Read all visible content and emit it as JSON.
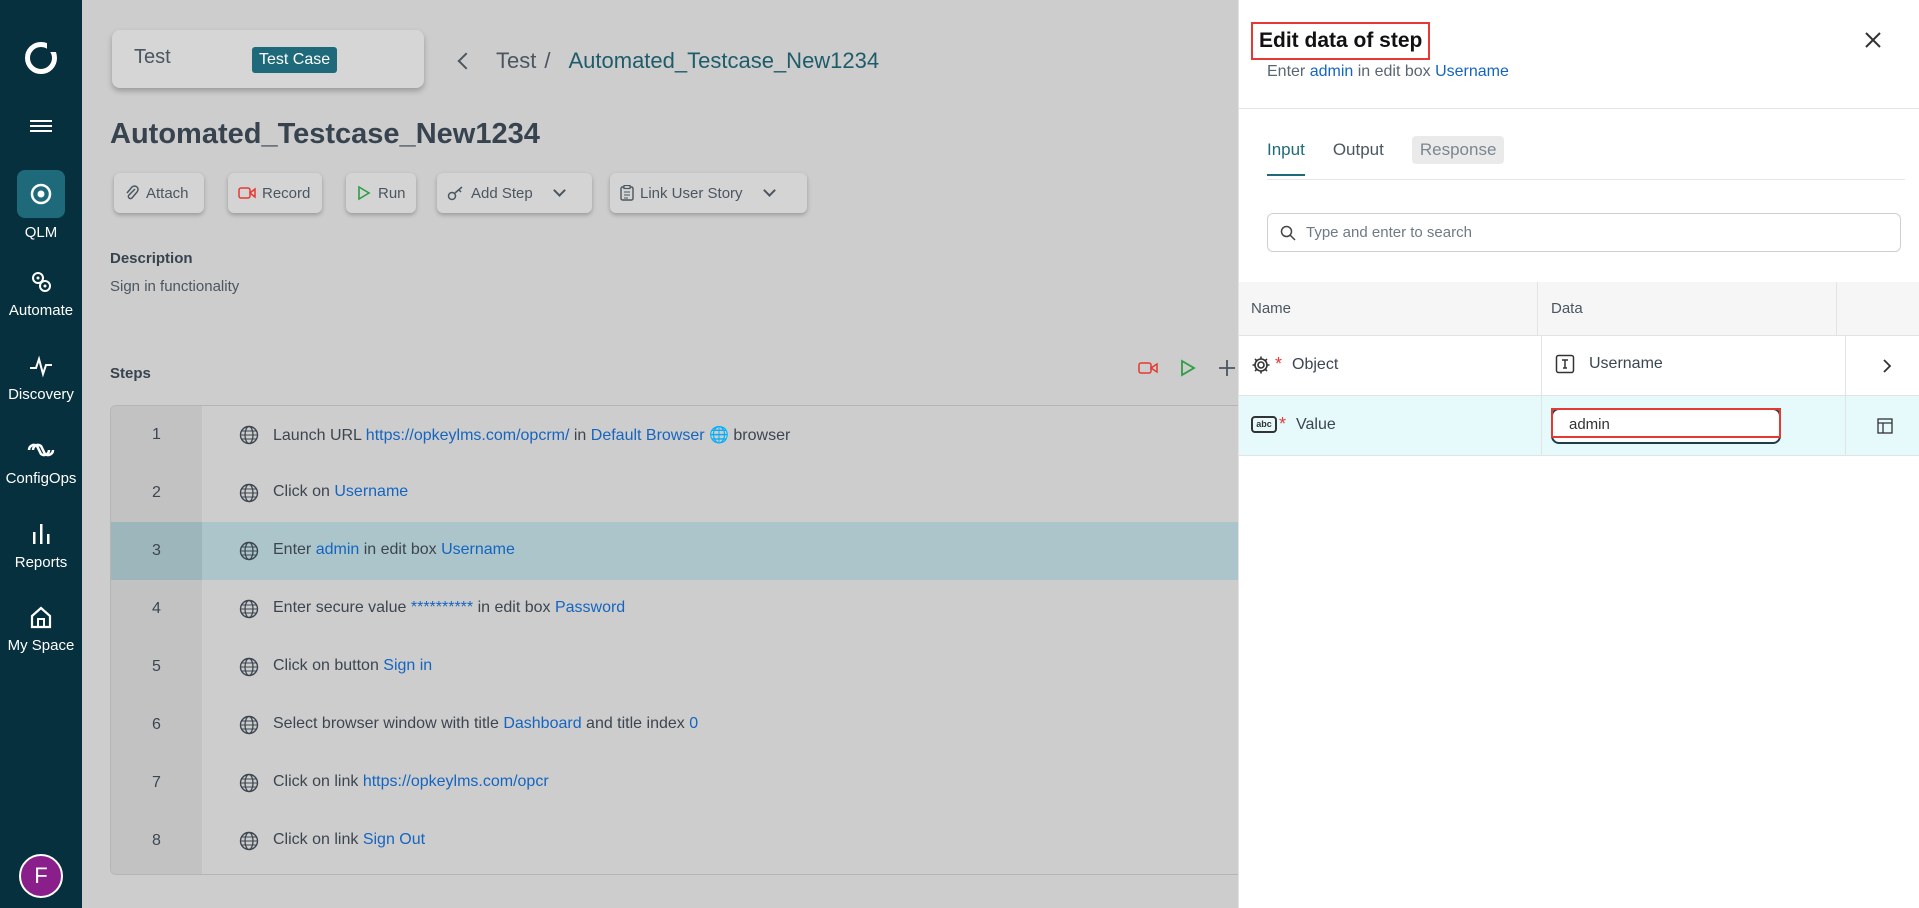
{
  "nav": {
    "items": [
      {
        "label": "QLM",
        "icon": "qlm-icon"
      },
      {
        "label": "Automate",
        "icon": "automate-icon"
      },
      {
        "label": "Discovery",
        "icon": "discovery-icon"
      },
      {
        "label": "ConfigOps",
        "icon": "configops-icon"
      },
      {
        "label": "Reports",
        "icon": "reports-icon"
      },
      {
        "label": "My Space",
        "icon": "home-icon"
      }
    ],
    "avatar_initial": "F"
  },
  "header": {
    "card_label": "Test",
    "card_badge": "Test Case",
    "breadcrumb_parent": "Test",
    "breadcrumb_sep": "/",
    "breadcrumb_current": "Automated_Testcase_New1234"
  },
  "page_title": "Automated_Testcase_New1234",
  "toolbar": {
    "attach": "Attach",
    "record": "Record",
    "run": "Run",
    "add_step": "Add Step",
    "link_user_story": "Link User Story"
  },
  "description": {
    "heading": "Description",
    "text": "Sign in functionality"
  },
  "steps": {
    "heading": "Steps",
    "rows": [
      {
        "num": "1",
        "parts": [
          [
            "Launch URL ",
            false
          ],
          [
            "https://opkeylms.com/opcrm/",
            true
          ],
          [
            " in ",
            false
          ],
          [
            "Default Browser",
            true
          ],
          [
            " 🌐 browser",
            false
          ]
        ]
      },
      {
        "num": "2",
        "parts": [
          [
            "Click on ",
            false
          ],
          [
            "Username",
            true
          ]
        ]
      },
      {
        "num": "3",
        "parts": [
          [
            "Enter ",
            false
          ],
          [
            "admin",
            true
          ],
          [
            " in edit box ",
            false
          ],
          [
            "Username",
            true
          ]
        ]
      },
      {
        "num": "4",
        "parts": [
          [
            "Enter secure value ",
            false
          ],
          [
            "**********",
            true
          ],
          [
            " in edit box ",
            false
          ],
          [
            "Password",
            true
          ]
        ]
      },
      {
        "num": "5",
        "parts": [
          [
            "Click on button ",
            false
          ],
          [
            "Sign in",
            true
          ]
        ]
      },
      {
        "num": "6",
        "parts": [
          [
            "Select browser window with title ",
            false
          ],
          [
            "Dashboard",
            true
          ],
          [
            " and title index ",
            false
          ],
          [
            "0",
            true
          ]
        ]
      },
      {
        "num": "7",
        "parts": [
          [
            "Click on link ",
            false
          ],
          [
            "https://opkeylms.com/opcr",
            true
          ]
        ]
      },
      {
        "num": "8",
        "parts": [
          [
            "Click on link ",
            false
          ],
          [
            "Sign Out",
            true
          ]
        ]
      }
    ],
    "selected_index": 2
  },
  "panel": {
    "title": "Edit data of step",
    "sub_prefix": "Enter ",
    "sub_value": "admin",
    "sub_middle": " in edit box ",
    "sub_object": "Username",
    "tabs": {
      "input": "Input",
      "output": "Output",
      "response": "Response"
    },
    "search_placeholder": "Type and enter to search",
    "columns": {
      "name": "Name",
      "data": "Data"
    },
    "rows": {
      "object_name": "Object",
      "object_value": "Username",
      "value_name": "Value",
      "value_value": "admin"
    }
  },
  "colors": {
    "rail": "#07303e",
    "accent": "#1f6a7a",
    "link": "#1565c0",
    "highlight": "#e53935"
  }
}
